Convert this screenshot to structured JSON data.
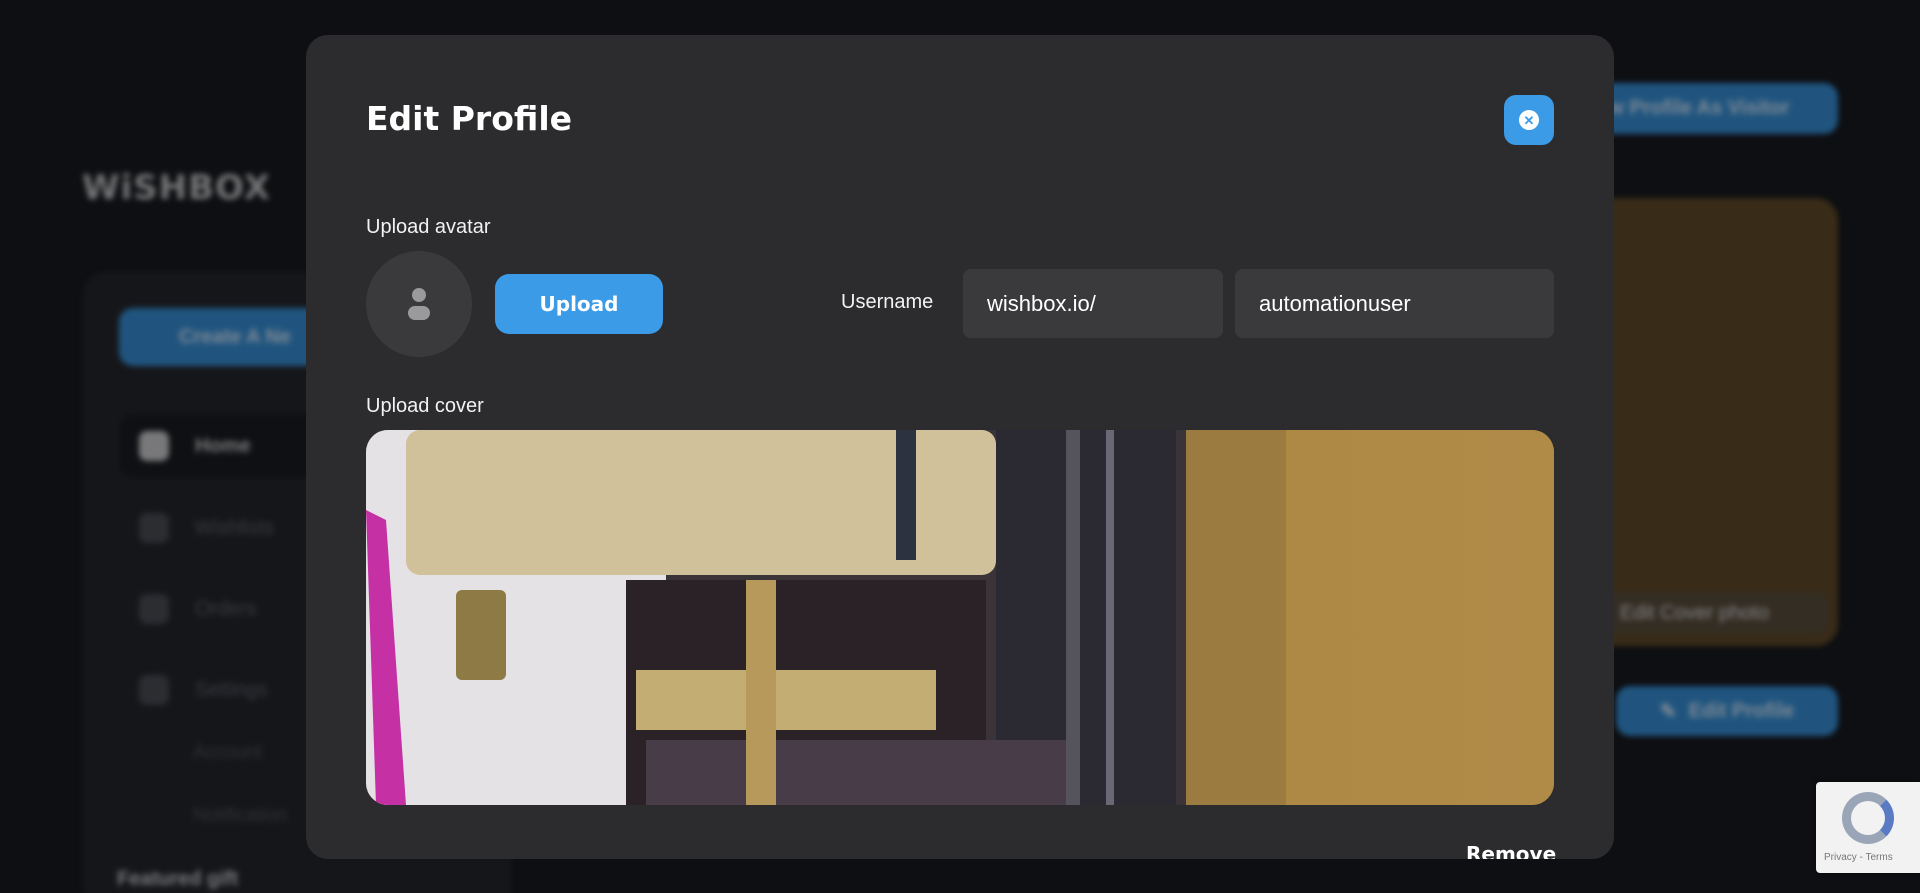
{
  "background": {
    "logo": "WiSHBOX",
    "sidebar": {
      "create_label": "Create A Ne",
      "nav": [
        {
          "label": "Home",
          "icon": "clipboard-icon",
          "active": true
        },
        {
          "label": "Wishlists",
          "icon": "gift-icon",
          "active": false
        },
        {
          "label": "Orders",
          "icon": "box-icon",
          "active": false
        },
        {
          "label": "Settings",
          "icon": "gear-icon",
          "active": false
        }
      ],
      "sub_items": [
        "Account",
        "Notification"
      ],
      "featured_label": "Featured gift"
    },
    "view_profile_label": "w Profile As Visitor",
    "edit_cover_label": "Edit Cover photo",
    "edit_profile_label": "Edit Profile",
    "recaptcha_terms": "Privacy - Terms"
  },
  "modal": {
    "title": "Edit Profile",
    "upload_avatar_label": "Upload avatar",
    "upload_button": "Upload",
    "username_label": "Username",
    "username_prefix": "wishbox.io/",
    "username_value": "automationuser",
    "upload_cover_label": "Upload cover",
    "remove_label": "Remove"
  },
  "colors": {
    "accent": "#3b9be6",
    "modal_bg": "#2c2c2e",
    "field_bg": "#3a3a3c",
    "page_bg": "#0e0f12"
  }
}
